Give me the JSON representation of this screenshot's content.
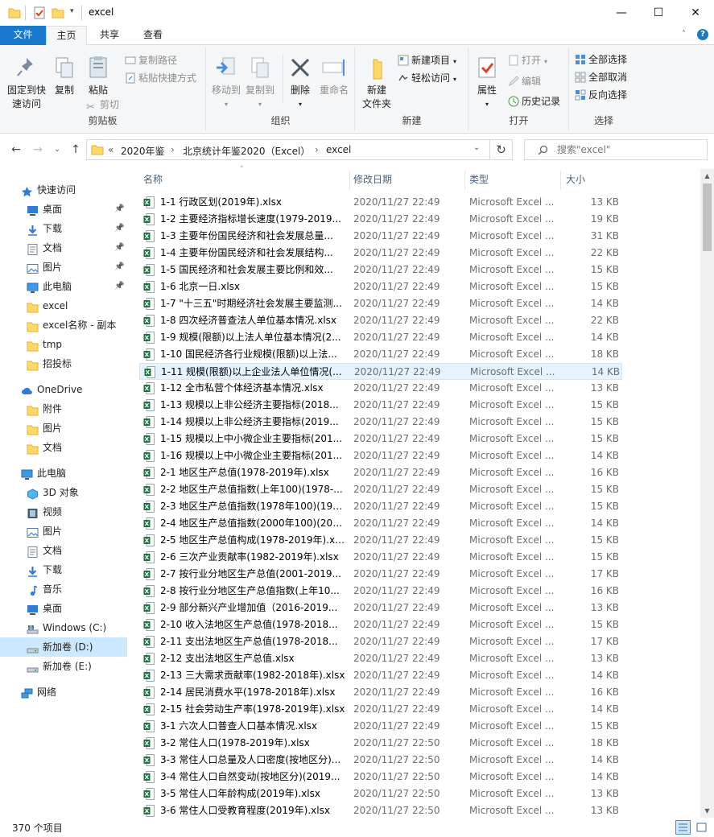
{
  "window": {
    "title": "excel",
    "minimize": "—",
    "maximize": "☐",
    "close": "✕"
  },
  "ribbon_tabs": [
    "文件",
    "主页",
    "共享",
    "查看"
  ],
  "ribbon": {
    "clipboard": {
      "pin_label_1": "固定到快",
      "pin_label_2": "速访问",
      "copy": "复制",
      "paste": "粘贴",
      "copy_path": "复制路径",
      "paste_shortcut": "粘贴快捷方式",
      "cut": "剪切",
      "group": "剪贴板"
    },
    "organize": {
      "move_to": "移动到",
      "copy_to": "复制到",
      "delete": "删除",
      "rename": "重命名",
      "group": "组织"
    },
    "new": {
      "new_folder_1": "新建",
      "new_folder_2": "文件夹",
      "new_item": "新建项目",
      "easy_access": "轻松访问",
      "group": "新建"
    },
    "open": {
      "properties": "属性",
      "open": "打开",
      "edit": "编辑",
      "history": "历史记录",
      "group": "打开"
    },
    "select": {
      "select_all": "全部选择",
      "select_none": "全部取消",
      "invert": "反向选择",
      "group": "选择"
    }
  },
  "address": {
    "crumbs": [
      "«",
      "2020年鉴",
      "›",
      "北京统计年鉴2020（Excel）",
      "›",
      "excel"
    ],
    "search_placeholder": "搜索\"excel\""
  },
  "nav": [
    {
      "label": "快速访问",
      "icon": "star-icon",
      "level": 0,
      "pinned": false
    },
    {
      "label": "桌面",
      "icon": "desktop-icon",
      "level": 1,
      "pinned": true
    },
    {
      "label": "下载",
      "icon": "download-icon",
      "level": 1,
      "pinned": true
    },
    {
      "label": "文档",
      "icon": "document-icon",
      "level": 1,
      "pinned": true
    },
    {
      "label": "图片",
      "icon": "picture-icon",
      "level": 1,
      "pinned": true
    },
    {
      "label": "此电脑",
      "icon": "computer-icon",
      "level": 1,
      "pinned": true
    },
    {
      "label": "excel",
      "icon": "folder-icon",
      "level": 1,
      "pinned": false
    },
    {
      "label": "excel名称 - 副本",
      "icon": "folder-icon",
      "level": 1,
      "pinned": false
    },
    {
      "label": "tmp",
      "icon": "folder-icon",
      "level": 1,
      "pinned": false
    },
    {
      "label": "招投标",
      "icon": "folder-icon",
      "level": 1,
      "pinned": false
    },
    {
      "label": "",
      "icon": "",
      "level": -1,
      "pinned": false
    },
    {
      "label": "OneDrive",
      "icon": "cloud-icon",
      "level": 0,
      "pinned": false
    },
    {
      "label": "附件",
      "icon": "folder-icon",
      "level": 1,
      "pinned": false
    },
    {
      "label": "图片",
      "icon": "folder-icon",
      "level": 1,
      "pinned": false
    },
    {
      "label": "文档",
      "icon": "folder-icon",
      "level": 1,
      "pinned": false
    },
    {
      "label": "",
      "icon": "",
      "level": -1,
      "pinned": false
    },
    {
      "label": "此电脑",
      "icon": "computer-icon",
      "level": 0,
      "pinned": false
    },
    {
      "label": "3D 对象",
      "icon": "3d-objects-icon",
      "level": 1,
      "pinned": false
    },
    {
      "label": "视频",
      "icon": "video-icon",
      "level": 1,
      "pinned": false
    },
    {
      "label": "图片",
      "icon": "picture-icon",
      "level": 1,
      "pinned": false
    },
    {
      "label": "文档",
      "icon": "document-icon",
      "level": 1,
      "pinned": false
    },
    {
      "label": "下载",
      "icon": "download-icon",
      "level": 1,
      "pinned": false
    },
    {
      "label": "音乐",
      "icon": "music-icon",
      "level": 1,
      "pinned": false
    },
    {
      "label": "桌面",
      "icon": "desktop-icon",
      "level": 1,
      "pinned": false
    },
    {
      "label": "Windows (C:)",
      "icon": "windows-drive-icon",
      "level": 1,
      "pinned": false
    },
    {
      "label": "新加卷 (D:)",
      "icon": "drive-icon",
      "level": 1,
      "pinned": false,
      "selected": true
    },
    {
      "label": "新加卷 (E:)",
      "icon": "drive-icon",
      "level": 1,
      "pinned": false
    },
    {
      "label": "",
      "icon": "",
      "level": -1,
      "pinned": false
    },
    {
      "label": "网络",
      "icon": "network-icon",
      "level": 0,
      "pinned": false
    }
  ],
  "columns": {
    "name": "名称",
    "date": "修改日期",
    "type": "类型",
    "size": "大小"
  },
  "files": [
    {
      "name": "1-1  行政区划(2019年).xlsx",
      "date": "2020/11/27 22:49",
      "type": "Microsoft Excel ...",
      "size": "13 KB"
    },
    {
      "name": "1-2  主要经济指标增长速度(1979-2019...",
      "date": "2020/11/27 22:49",
      "type": "Microsoft Excel ...",
      "size": "19 KB"
    },
    {
      "name": "1-3  主要年份国民经济和社会发展总量...",
      "date": "2020/11/27 22:49",
      "type": "Microsoft Excel ...",
      "size": "31 KB"
    },
    {
      "name": "1-4  主要年份国民经济和社会发展结构...",
      "date": "2020/11/27 22:49",
      "type": "Microsoft Excel ...",
      "size": "22 KB"
    },
    {
      "name": "1-5  国民经济和社会发展主要比例和效...",
      "date": "2020/11/27 22:49",
      "type": "Microsoft Excel ...",
      "size": "15 KB"
    },
    {
      "name": "1-6  北京一日.xlsx",
      "date": "2020/11/27 22:49",
      "type": "Microsoft Excel ...",
      "size": "15 KB"
    },
    {
      "name": "1-7 \"十三五\"时期经济社会发展主要监测...",
      "date": "2020/11/27 22:49",
      "type": "Microsoft Excel ...",
      "size": "14 KB"
    },
    {
      "name": "1-8  四次经济普查法人单位基本情况.xlsx",
      "date": "2020/11/27 22:49",
      "type": "Microsoft Excel ...",
      "size": "22 KB"
    },
    {
      "name": "1-9  规模(限额)以上法人单位基本情况(2...",
      "date": "2020/11/27 22:49",
      "type": "Microsoft Excel ...",
      "size": "14 KB"
    },
    {
      "name": "1-10  国民经济各行业规模(限额)以上法...",
      "date": "2020/11/27 22:49",
      "type": "Microsoft Excel ...",
      "size": "18 KB"
    },
    {
      "name": "1-11  规模(限额)以上企业法人单位情况(...",
      "date": "2020/11/27 22:49",
      "type": "Microsoft Excel ...",
      "size": "14 KB",
      "hover": true
    },
    {
      "name": "1-12  全市私营个体经济基本情况.xlsx",
      "date": "2020/11/27 22:49",
      "type": "Microsoft Excel ...",
      "size": "13 KB"
    },
    {
      "name": "1-13  规模以上非公经济主要指标(2018...",
      "date": "2020/11/27 22:49",
      "type": "Microsoft Excel ...",
      "size": "15 KB"
    },
    {
      "name": "1-14  规模以上非公经济主要指标(2019...",
      "date": "2020/11/27 22:49",
      "type": "Microsoft Excel ...",
      "size": "15 KB"
    },
    {
      "name": "1-15  规模以上中小微企业主要指标(201...",
      "date": "2020/11/27 22:49",
      "type": "Microsoft Excel ...",
      "size": "15 KB"
    },
    {
      "name": "1-16  规模以上中小微企业主要指标(201...",
      "date": "2020/11/27 22:49",
      "type": "Microsoft Excel ...",
      "size": "14 KB"
    },
    {
      "name": "2-1  地区生产总值(1978-2019年).xlsx",
      "date": "2020/11/27 22:49",
      "type": "Microsoft Excel ...",
      "size": "16 KB"
    },
    {
      "name": "2-2  地区生产总值指数(上年100)(1978-...",
      "date": "2020/11/27 22:49",
      "type": "Microsoft Excel ...",
      "size": "15 KB"
    },
    {
      "name": "2-3  地区生产总值指数(1978年100)(197...",
      "date": "2020/11/27 22:49",
      "type": "Microsoft Excel ...",
      "size": "15 KB"
    },
    {
      "name": "2-4  地区生产总值指数(2000年100)(200...",
      "date": "2020/11/27 22:49",
      "type": "Microsoft Excel ...",
      "size": "14 KB"
    },
    {
      "name": "2-5  地区生产总值构成(1978-2019年).xl...",
      "date": "2020/11/27 22:49",
      "type": "Microsoft Excel ...",
      "size": "15 KB"
    },
    {
      "name": "2-6  三次产业贡献率(1982-2019年).xlsx",
      "date": "2020/11/27 22:49",
      "type": "Microsoft Excel ...",
      "size": "15 KB"
    },
    {
      "name": "2-7  按行业分地区生产总值(2001-2019...",
      "date": "2020/11/27 22:49",
      "type": "Microsoft Excel ...",
      "size": "17 KB"
    },
    {
      "name": "2-8  按行业分地区生产总值指数(上年10...",
      "date": "2020/11/27 22:49",
      "type": "Microsoft Excel ...",
      "size": "16 KB"
    },
    {
      "name": "2-9  部分新兴产业增加值（2016-2019...",
      "date": "2020/11/27 22:49",
      "type": "Microsoft Excel ...",
      "size": "13 KB"
    },
    {
      "name": "2-10  收入法地区生产总值(1978-2018...",
      "date": "2020/11/27 22:49",
      "type": "Microsoft Excel ...",
      "size": "15 KB"
    },
    {
      "name": "2-11  支出法地区生产总值(1978-2018...",
      "date": "2020/11/27 22:49",
      "type": "Microsoft Excel ...",
      "size": "17 KB"
    },
    {
      "name": "2-12  支出法地区生产总值.xlsx",
      "date": "2020/11/27 22:49",
      "type": "Microsoft Excel ...",
      "size": "13 KB"
    },
    {
      "name": "2-13  三大需求贡献率(1982-2018年).xlsx",
      "date": "2020/11/27 22:49",
      "type": "Microsoft Excel ...",
      "size": "14 KB"
    },
    {
      "name": "2-14  居民消费水平(1978-2018年).xlsx",
      "date": "2020/11/27 22:49",
      "type": "Microsoft Excel ...",
      "size": "16 KB"
    },
    {
      "name": "2-15  社会劳动生产率(1978-2019年).xlsx",
      "date": "2020/11/27 22:49",
      "type": "Microsoft Excel ...",
      "size": "14 KB"
    },
    {
      "name": "3-1  六次人口普查人口基本情况.xlsx",
      "date": "2020/11/27 22:49",
      "type": "Microsoft Excel ...",
      "size": "15 KB"
    },
    {
      "name": "3-2  常住人口(1978-2019年).xlsx",
      "date": "2020/11/27 22:50",
      "type": "Microsoft Excel ...",
      "size": "18 KB"
    },
    {
      "name": "3-3  常住人口总量及人口密度(按地区分)...",
      "date": "2020/11/27 22:50",
      "type": "Microsoft Excel ...",
      "size": "14 KB"
    },
    {
      "name": "3-4  常住人口自然变动(按地区分)(2019...",
      "date": "2020/11/27 22:50",
      "type": "Microsoft Excel ...",
      "size": "14 KB"
    },
    {
      "name": "3-5  常住人口年龄构成(2019年).xlsx",
      "date": "2020/11/27 22:50",
      "type": "Microsoft Excel ...",
      "size": "13 KB"
    },
    {
      "name": "3-6  常住人口受教育程度(2019年).xlsx",
      "date": "2020/11/27 22:50",
      "type": "Microsoft Excel ...",
      "size": "13 KB"
    }
  ],
  "status": {
    "count": "370 个项目"
  },
  "colors": {
    "accent": "#1979ca",
    "folder": "#ffd86a",
    "excel_green": "#1d7044",
    "selected_bg": "#cce8ff",
    "hover_bg": "#e5f3ff"
  }
}
